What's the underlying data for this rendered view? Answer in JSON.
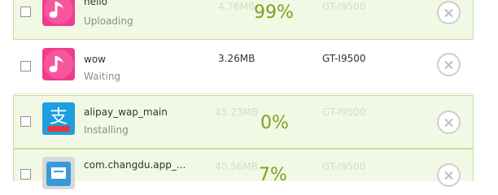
{
  "colors": {
    "accent_green": "#7aa21d",
    "active_bg": "#f1f8e4",
    "active_border": "#c7df99"
  },
  "rows": [
    {
      "name": "hello",
      "status": "Uploading",
      "size": "4.76MB",
      "device": "GT-I9500",
      "percent": "99%",
      "icon": "music-note-icon"
    },
    {
      "name": "wow",
      "status": "Waiting",
      "size": "3.26MB",
      "device": "GT-I9500",
      "percent": "",
      "icon": "music-note-icon"
    },
    {
      "name": "alipay_wap_main",
      "status": "Installing",
      "size": "45.23MB",
      "device": "GT-I9500",
      "percent": "0%",
      "icon": "alipay-icon"
    },
    {
      "name": "com.changdu.app_...",
      "status": "",
      "size": "40.56MB",
      "device": "GT-I9500",
      "percent": "7%",
      "icon": "reader-app-icon"
    }
  ]
}
